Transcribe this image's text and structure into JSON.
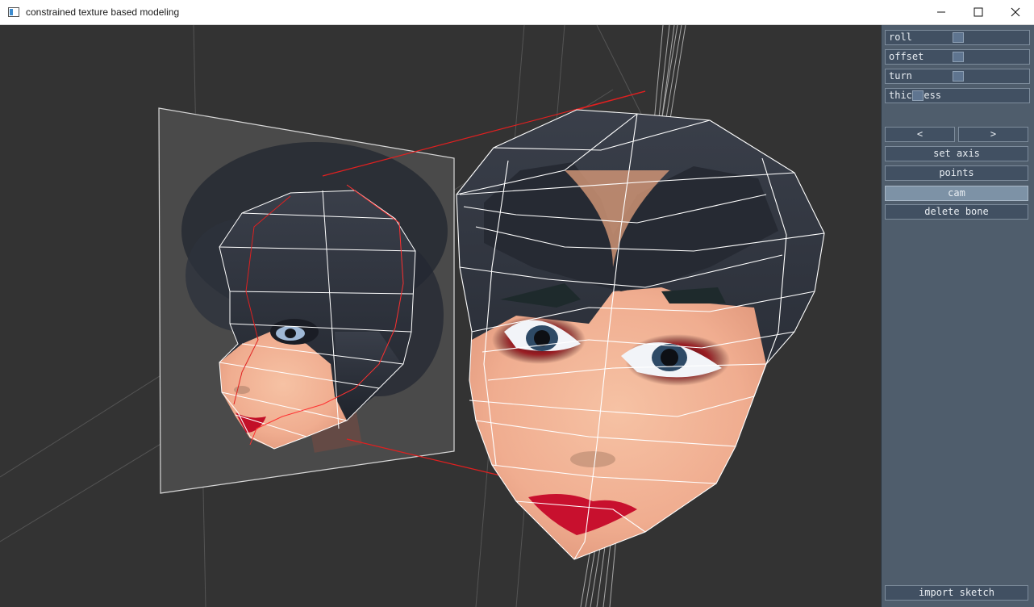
{
  "window": {
    "title": "constrained texture based modeling"
  },
  "panel": {
    "sliders": [
      {
        "label": "roll",
        "value": 0.5
      },
      {
        "label": "offset",
        "value": 0.5
      },
      {
        "label": "turn",
        "value": 0.5
      },
      {
        "label": "thickness",
        "value": 0.2
      }
    ],
    "prev_label": "<",
    "next_label": ">",
    "set_axis_label": "set axis",
    "points_label": "points",
    "cam_label": "cam",
    "delete_bone_label": "delete bone",
    "import_sketch_label": "import sketch"
  },
  "colors": {
    "viewport_bg": "#333333",
    "panel_bg": "#4f5d6c",
    "active_button": "#7d92a6",
    "constraint_line": "#e02020"
  }
}
